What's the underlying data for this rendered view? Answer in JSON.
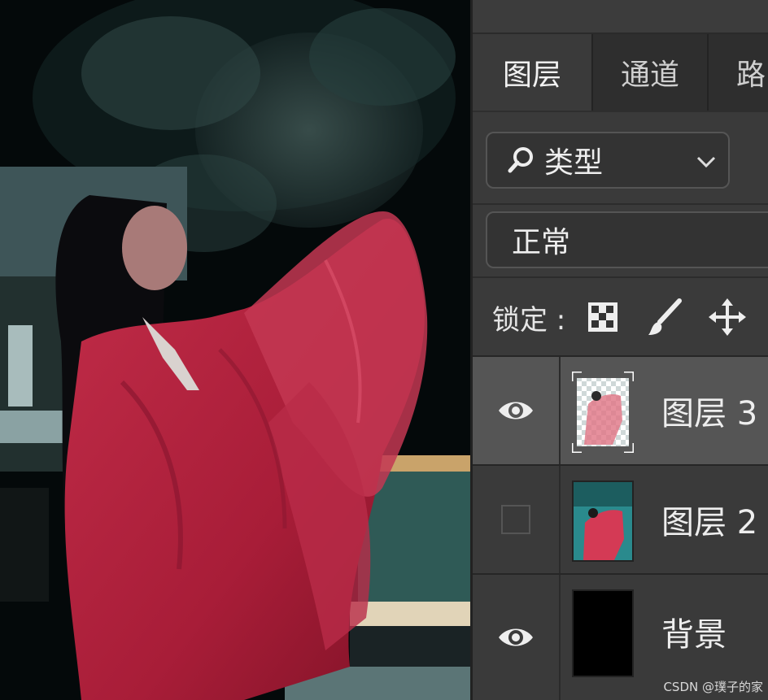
{
  "panel": {
    "tabs": [
      {
        "label": "图层"
      },
      {
        "label": "通道"
      },
      {
        "label": "路"
      }
    ],
    "filter": {
      "label": "类型",
      "icon": "search-icon"
    },
    "blend_mode": "正常",
    "lock": {
      "label": "锁定 :",
      "icons": [
        "lock-transparent-pixels-icon",
        "lock-image-pixels-icon",
        "lock-position-icon"
      ]
    },
    "layers": [
      {
        "name": "图层 3",
        "visible": true,
        "selected": true,
        "thumbnail": "transparent-figure-thumbnail"
      },
      {
        "name": "图层 2",
        "visible": false,
        "selected": false,
        "thumbnail": "photo-thumbnail"
      },
      {
        "name": "背景",
        "visible": true,
        "selected": false,
        "thumbnail": "black-thumbnail"
      }
    ]
  },
  "watermark": "CSDN @璞子的家",
  "colors": {
    "panel_bg": "#3a3a3a",
    "selected_layer": "#555555",
    "robe_red": "#b8253f"
  }
}
